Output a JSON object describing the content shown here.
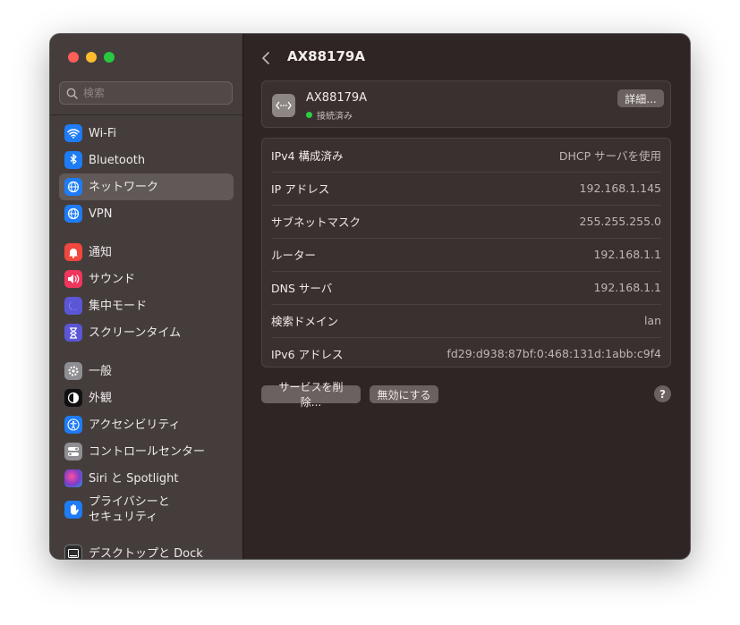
{
  "search": {
    "placeholder": "検索"
  },
  "sidebar": {
    "items": [
      {
        "label": "Wi-Fi",
        "icon": "wifi-icon",
        "color": "#1e7cf6"
      },
      {
        "label": "Bluetooth",
        "icon": "bluetooth-icon",
        "color": "#1e7cf6"
      },
      {
        "label": "ネットワーク",
        "icon": "globe-icon",
        "color": "#1e7cf6"
      },
      {
        "label": "VPN",
        "icon": "vpn-globe-icon",
        "color": "#1e7cf6"
      },
      {
        "label": "通知",
        "icon": "bell-icon",
        "color": "#f0473e"
      },
      {
        "label": "サウンド",
        "icon": "speaker-icon",
        "color": "#f0365d"
      },
      {
        "label": "集中モード",
        "icon": "moon-icon",
        "color": "#5b56d6"
      },
      {
        "label": "スクリーンタイム",
        "icon": "hourglass-icon",
        "color": "#5b56d6"
      },
      {
        "label": "一般",
        "icon": "gear-icon",
        "color": "#8e8e93"
      },
      {
        "label": "外観",
        "icon": "appearance-icon",
        "color": "#111111"
      },
      {
        "label": "アクセシビリティ",
        "icon": "accessibility-icon",
        "color": "#1e7cf6"
      },
      {
        "label": "コントロールセンター",
        "icon": "toggles-icon",
        "color": "#8e8e93"
      },
      {
        "label": "Siri と Spotlight",
        "icon": "siri-icon",
        "color": "#7a3cc9"
      },
      {
        "label": "プライバシーと\nセキュリティ",
        "icon": "hand-icon",
        "color": "#1e7cf6"
      },
      {
        "label": "デスクトップと Dock",
        "icon": "dock-icon",
        "color": "#2b2b2b"
      }
    ]
  },
  "header": {
    "title": "AX88179A"
  },
  "device": {
    "name": "AX88179A",
    "status": "接続済み",
    "status_color": "#2ecc40",
    "details_button": "詳細..."
  },
  "details": [
    {
      "key": "IPv4 構成済み",
      "value": "DHCP サーバを使用"
    },
    {
      "key": "IP アドレス",
      "value": "192.168.1.145"
    },
    {
      "key": "サブネットマスク",
      "value": "255.255.255.0"
    },
    {
      "key": "ルーター",
      "value": "192.168.1.1"
    },
    {
      "key": "DNS サーバ",
      "value": "192.168.1.1"
    },
    {
      "key": "検索ドメイン",
      "value": "lan"
    },
    {
      "key": "IPv6 アドレス",
      "value": "fd29:d938:87bf:0:468:131d:1abb:c9f4"
    }
  ],
  "footer": {
    "remove_button": "サービスを削除...",
    "disable_button": "無効にする",
    "help_label": "?"
  }
}
